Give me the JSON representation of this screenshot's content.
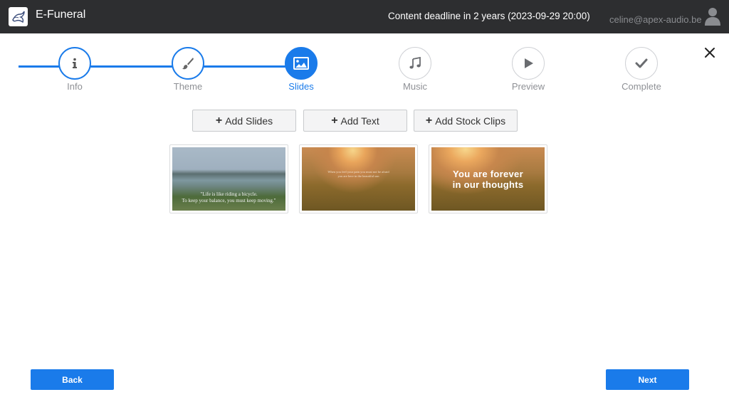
{
  "app": {
    "title": "E-Funeral"
  },
  "header": {
    "deadline_text": "Content deadline in 2 years (2023-09-29 20:00)",
    "user_email": "celine@apex-audio.be"
  },
  "stepper": {
    "steps": [
      {
        "label": "Info",
        "icon": "info-icon",
        "state": "done"
      },
      {
        "label": "Theme",
        "icon": "brush-icon",
        "state": "done"
      },
      {
        "label": "Slides",
        "icon": "image-icon",
        "state": "active"
      },
      {
        "label": "Music",
        "icon": "music-icon",
        "state": "todo"
      },
      {
        "label": "Preview",
        "icon": "play-icon",
        "state": "todo"
      },
      {
        "label": "Complete",
        "icon": "check-icon",
        "state": "todo"
      }
    ]
  },
  "actions": {
    "add_slides": "Add Slides",
    "add_text": "Add Text",
    "add_stock_clips": "Add Stock Clips"
  },
  "slides": [
    {
      "caption_line1": "\"Life is like riding a bicycle.",
      "caption_line2": "To keep your balance, you must keep moving.\""
    },
    {
      "caption_line1": "When you feel your pain you must not be afraid",
      "caption_line2": "you are here in the beautiful sun"
    },
    {
      "caption_line1": "You are forever",
      "caption_line2": "in our thoughts"
    }
  ],
  "nav": {
    "back": "Back",
    "next": "Next"
  },
  "colors": {
    "accent": "#1a7bea",
    "header_bg": "#2d2e30",
    "inactive": "#8e9095"
  }
}
